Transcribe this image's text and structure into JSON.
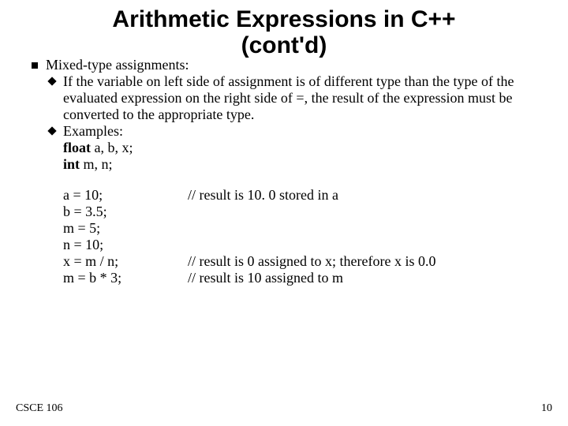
{
  "title_line1": "Arithmetic Expressions in C++",
  "title_line2": "(cont'd)",
  "bullet1": "Mixed-type assignments:",
  "sub1": "If the variable on left side of assignment is of different type than the type of the evaluated expression on the right side of =, the result of the expression must be converted to the appropriate type.",
  "sub2": "Examples:",
  "decl": {
    "float_kw": "float",
    "float_vars": " a, b, x;",
    "int_kw": "int",
    "int_vars": " m, n;"
  },
  "code": [
    {
      "l": "a = 10;",
      "r": "// result is 10. 0 stored in a"
    },
    {
      "l": "b = 3.5;",
      "r": ""
    },
    {
      "l": "m = 5;",
      "r": ""
    },
    {
      "l": "n = 10;",
      "r": ""
    },
    {
      "l": "x = m / n;",
      "r": "// result is 0 assigned to x; therefore x is 0.0"
    },
    {
      "l": "m = b * 3;",
      "r": "// result is 10 assigned to m"
    }
  ],
  "footer": {
    "left": "CSCE 106",
    "right": "10"
  }
}
